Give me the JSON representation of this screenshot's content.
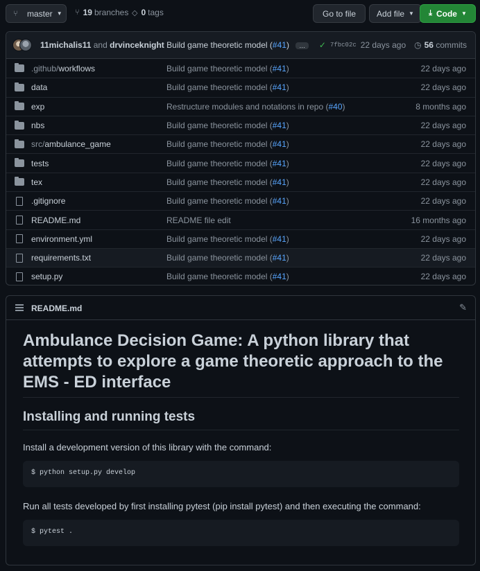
{
  "toolbar": {
    "branch_label": "master",
    "branches_count": "19",
    "branches_label": "branches",
    "tags_count": "0",
    "tags_label": "tags",
    "goto_file_label": "Go to file",
    "add_file_label": "Add file",
    "code_label": "Code"
  },
  "latest_commit": {
    "author1": "11michalis11",
    "and": "and",
    "author2": "drvinceknight",
    "message": "Build game theoretic model (",
    "pr": "#41",
    "message_end": ")",
    "ellipsis": "…",
    "sha": "7fbc02c",
    "age": "22 days ago",
    "commits_count": "56",
    "commits_label": "commits"
  },
  "files": [
    {
      "type": "dir",
      "name_dim": ".github/",
      "name": "workflows",
      "msg": "Build game theoretic model (",
      "pr": "#41",
      "msg_end": ")",
      "age": "22 days ago"
    },
    {
      "type": "dir",
      "name_dim": "",
      "name": "data",
      "msg": "Build game theoretic model (",
      "pr": "#41",
      "msg_end": ")",
      "age": "22 days ago"
    },
    {
      "type": "dir",
      "name_dim": "",
      "name": "exp",
      "msg": "Restructure modules and notations in repo (",
      "pr": "#40",
      "msg_end": ")",
      "age": "8 months ago"
    },
    {
      "type": "dir",
      "name_dim": "",
      "name": "nbs",
      "msg": "Build game theoretic model (",
      "pr": "#41",
      "msg_end": ")",
      "age": "22 days ago"
    },
    {
      "type": "dir",
      "name_dim": "src/",
      "name": "ambulance_game",
      "msg": "Build game theoretic model (",
      "pr": "#41",
      "msg_end": ")",
      "age": "22 days ago"
    },
    {
      "type": "dir",
      "name_dim": "",
      "name": "tests",
      "msg": "Build game theoretic model (",
      "pr": "#41",
      "msg_end": ")",
      "age": "22 days ago"
    },
    {
      "type": "dir",
      "name_dim": "",
      "name": "tex",
      "msg": "Build game theoretic model (",
      "pr": "#41",
      "msg_end": ")",
      "age": "22 days ago"
    },
    {
      "type": "file",
      "name_dim": "",
      "name": ".gitignore",
      "msg": "Build game theoretic model (",
      "pr": "#41",
      "msg_end": ")",
      "age": "22 days ago"
    },
    {
      "type": "file",
      "name_dim": "",
      "name": "README.md",
      "msg": "README file edit",
      "pr": "",
      "msg_end": "",
      "age": "16 months ago"
    },
    {
      "type": "file",
      "name_dim": "",
      "name": "environment.yml",
      "msg": "Build game theoretic model (",
      "pr": "#41",
      "msg_end": ")",
      "age": "22 days ago"
    },
    {
      "type": "file",
      "name_dim": "",
      "name": "requirements.txt",
      "msg": "Build game theoretic model (",
      "pr": "#41",
      "msg_end": ")",
      "age": "22 days ago"
    },
    {
      "type": "file",
      "name_dim": "",
      "name": "setup.py",
      "msg": "Build game theoretic model (",
      "pr": "#41",
      "msg_end": ")",
      "age": "22 days ago"
    }
  ],
  "readme": {
    "filename": "README.md",
    "h1": "Ambulance Decision Game: A python library that attempts to explore a game theoretic approach to the EMS - ED interface",
    "h2": "Installing and running tests",
    "p1": "Install a development version of this library with the command:",
    "code1": "$ python setup.py develop",
    "p2": "Run all tests developed by first installing pytest (pip install pytest) and then executing the command:",
    "code2": "$ pytest ."
  },
  "icons": {
    "branch": "git-branch-icon",
    "tag": "tag-icon",
    "check": "check-icon",
    "history": "history-icon",
    "folder": "folder-icon",
    "file": "file-icon",
    "list": "list-icon",
    "pencil": "pencil-icon",
    "download": "download-icon"
  },
  "colors": {
    "background": "#0d1117",
    "accent_link": "#58a6ff",
    "code_button": "#238636",
    "success_check": "#3fb950"
  }
}
